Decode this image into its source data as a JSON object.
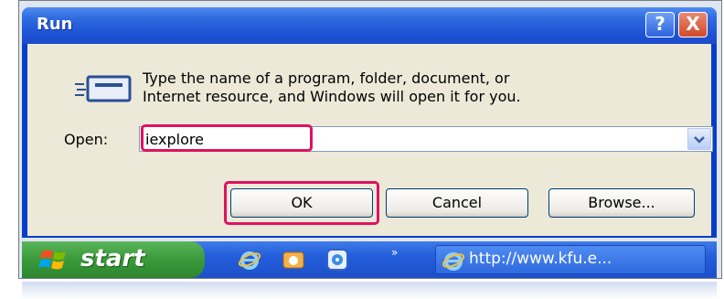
{
  "window": {
    "title": "Run",
    "help_label": "?",
    "close_label": "X"
  },
  "dialog": {
    "description_line1": "Type the name of a program, folder, document, or",
    "description_line2": "Internet resource, and Windows will open it for you.",
    "open_label": "Open:",
    "open_value": "iexplore",
    "ok_label": "OK",
    "cancel_label": "Cancel",
    "browse_label": "Browse..."
  },
  "taskbar": {
    "start_label": "start",
    "quicklaunch": [
      "ie-icon",
      "mail-icon",
      "media-icon"
    ],
    "overflow_label": "»",
    "task_label": "http://www.kfu.e..."
  },
  "colors": {
    "highlight": "#e0115f",
    "title_blue": "#1e54d6",
    "start_green": "#3a993a"
  }
}
